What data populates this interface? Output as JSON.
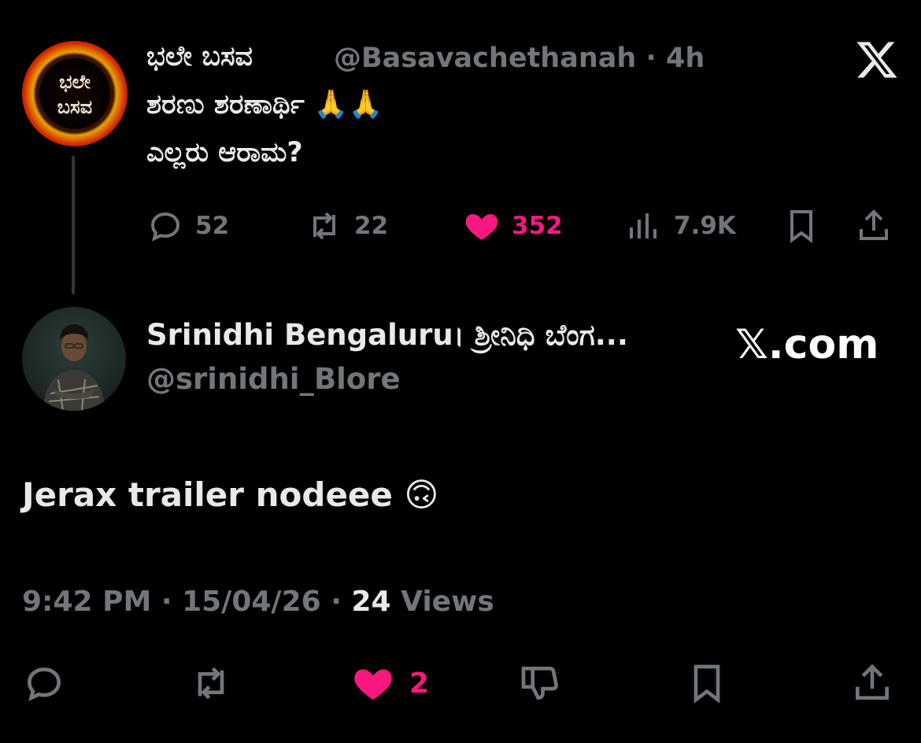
{
  "parent_tweet": {
    "display_name": "ಭಲೇ ಬಸವ",
    "handle": "@Basavachethanah",
    "separator": "·",
    "time_ago": "4h",
    "avatar_text_top": "ಭಲೇ",
    "avatar_text_bottom": "ಬಸವ",
    "text_line1": "ಶರಣು ಶರಣಾರ್ಥಿ 🙏🙏",
    "text_line2": "ಎಲ್ಲರು ಆರಾಮ?",
    "replies": "52",
    "reposts": "22",
    "likes": "352",
    "views": "7.9K",
    "liked": true
  },
  "reply_tweet": {
    "display_name": "Srinidhi Bengaluru। ಶ್ರೀನಿಧಿ ಬೆಂಗ...",
    "handle": "@srinidhi_Blore",
    "watermark": "𝕏.com",
    "text": "Jerax trailer nodeee 🙃",
    "time": "9:42 PM",
    "date": "15/04/26",
    "sep": "·",
    "views_count": "24",
    "views_label": "Views",
    "likes": "2",
    "liked": true
  },
  "icons": {
    "reply": "reply-icon",
    "repost": "repost-icon",
    "like": "heart-icon",
    "views": "views-icon",
    "bookmark": "bookmark-icon",
    "share": "share-icon",
    "dislike": "dislike-icon",
    "close": "x-logo-icon"
  },
  "colors": {
    "background": "#000000",
    "text": "#e7e9ea",
    "secondary": "#71767b",
    "like": "#f91880",
    "thread_line": "#333639"
  }
}
